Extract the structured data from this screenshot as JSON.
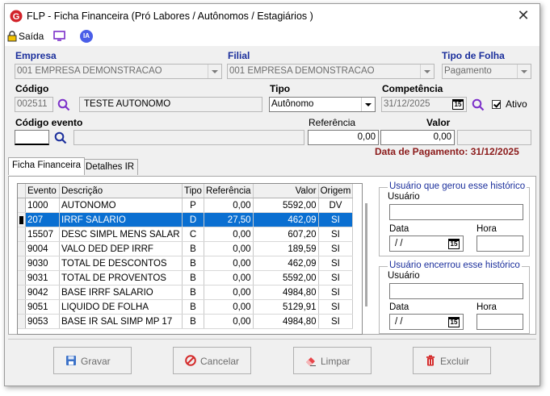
{
  "window": {
    "title": "FLP - Ficha Financeira (Pró Labores / Autônomos / Estagiários )",
    "close_glyph": "✕",
    "logo_icon": "app-logo-icon",
    "logo_letter": "G"
  },
  "toolbar": {
    "exit_label": "Saída",
    "ia_label": "IA"
  },
  "empresa": {
    "label": "Empresa",
    "value": "001 EMPRESA DEMONSTRACAO"
  },
  "filial": {
    "label": "Filial",
    "value": "001 EMPRESA DEMONSTRACAO"
  },
  "tipo_folha": {
    "label": "Tipo de Folha",
    "value": "Pagamento"
  },
  "codigo": {
    "label": "Código",
    "code": "002511",
    "name": "TESTE AUTONOMO"
  },
  "tipo": {
    "label": "Tipo",
    "value": "Autônomo"
  },
  "competencia": {
    "label": "Competência",
    "value": "31/12/2025",
    "ativo_label": "Ativo",
    "ativo_checked": true
  },
  "codigo_evento": {
    "label": "Código evento",
    "code": "",
    "desc": ""
  },
  "referencia": {
    "label": "Referência",
    "value": "0,00"
  },
  "valor": {
    "label": "Valor",
    "value": "0,00"
  },
  "data_pagamento": "Data de Pagamento: 31/12/2025",
  "tabs": [
    {
      "label": "Ficha Financeira",
      "selected": true
    },
    {
      "label": "Detalhes IR",
      "selected": false
    }
  ],
  "grid": {
    "columns": [
      "Evento",
      "Descrição",
      "Tipo",
      "Referência",
      "Valor",
      "Origem"
    ],
    "rows": [
      {
        "evento": "1000",
        "descricao": "AUTONOMO",
        "tipo": "P",
        "referencia": "0,00",
        "valor": "5592,00",
        "origem": "DV",
        "selected": false
      },
      {
        "evento": "207",
        "descricao": "IRRF SALARIO",
        "tipo": "D",
        "referencia": "27,50",
        "valor": "462,09",
        "origem": "SI",
        "selected": true
      },
      {
        "evento": "15507",
        "descricao": "DESC SIMPL MENS SALAR",
        "tipo": "C",
        "referencia": "0,00",
        "valor": "607,20",
        "origem": "SI",
        "selected": false
      },
      {
        "evento": "9004",
        "descricao": "VALO DED DEP IRRF",
        "tipo": "B",
        "referencia": "0,00",
        "valor": "189,59",
        "origem": "SI",
        "selected": false
      },
      {
        "evento": "9030",
        "descricao": "TOTAL DE DESCONTOS",
        "tipo": "B",
        "referencia": "0,00",
        "valor": "462,09",
        "origem": "SI",
        "selected": false
      },
      {
        "evento": "9031",
        "descricao": "TOTAL DE PROVENTOS",
        "tipo": "B",
        "referencia": "0,00",
        "valor": "5592,00",
        "origem": "SI",
        "selected": false
      },
      {
        "evento": "9042",
        "descricao": "BASE IRRF SALARIO",
        "tipo": "B",
        "referencia": "0,00",
        "valor": "4984,80",
        "origem": "SI",
        "selected": false
      },
      {
        "evento": "9051",
        "descricao": "LIQUIDO DE FOLHA",
        "tipo": "B",
        "referencia": "0,00",
        "valor": "5129,91",
        "origem": "SI",
        "selected": false
      },
      {
        "evento": "9053",
        "descricao": "BASE IR SAL SIMP MP 17",
        "tipo": "B",
        "referencia": "0,00",
        "valor": "4984,80",
        "origem": "SI",
        "selected": false
      }
    ]
  },
  "gerou": {
    "caption": "Usuário que gerou esse histórico",
    "usuario_label": "Usuário",
    "usuario_value": "",
    "data_label": "Data",
    "data_value": "/ /",
    "hora_label": "Hora",
    "hora_value": ""
  },
  "encerrou": {
    "caption": "Usuário encerrou esse histórico",
    "usuario_label": "Usuário",
    "usuario_value": "",
    "data_label": "Data",
    "data_value": "/ /",
    "hora_label": "Hora",
    "hora_value": ""
  },
  "calendar_glyph": "15",
  "buttons": {
    "gravar": "Gravar",
    "cancelar": "Cancelar",
    "limpar": "Limpar",
    "excluir": "Excluir"
  },
  "colors": {
    "label_blue": "#1b2f9c",
    "selection": "#0a6fd1",
    "payment_date": "#8b1a1a",
    "search_icon": "#7b2fc9"
  }
}
